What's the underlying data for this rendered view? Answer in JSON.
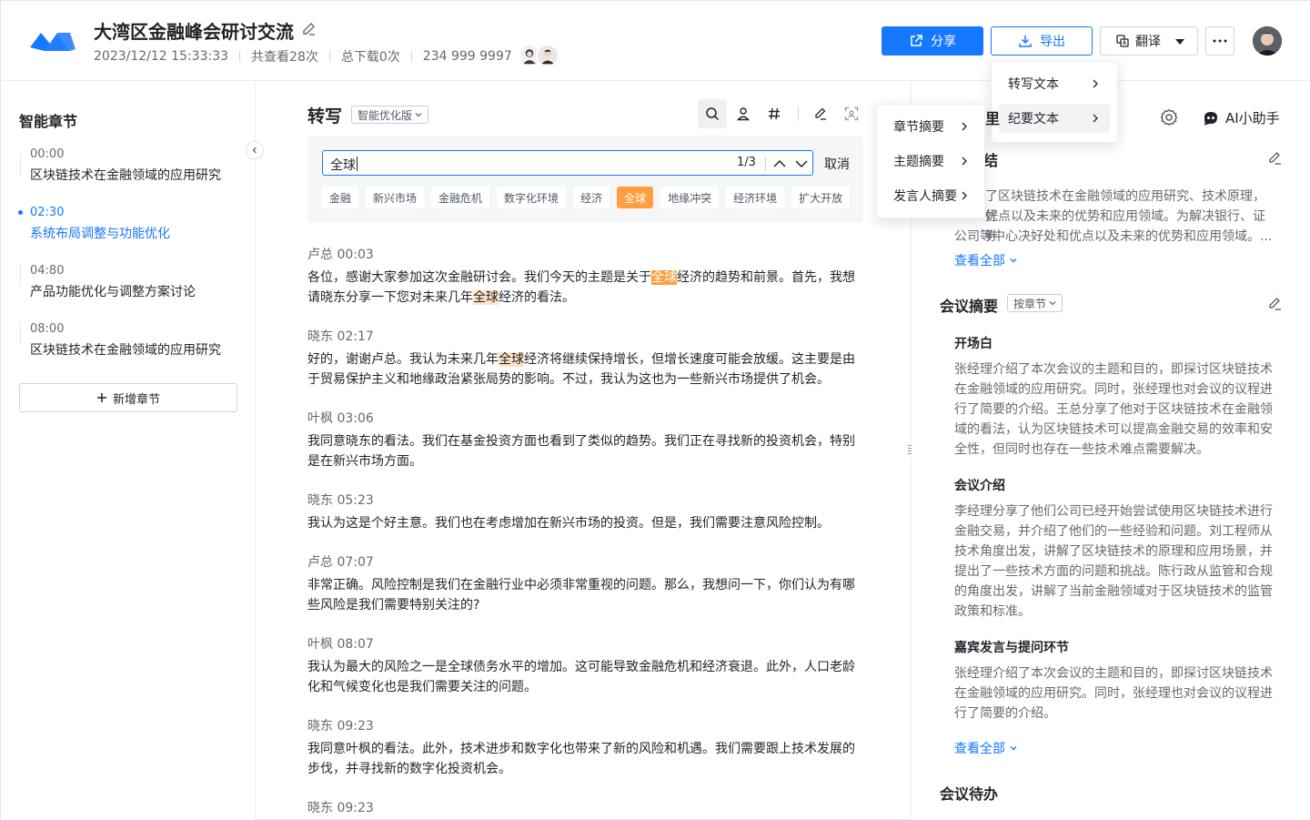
{
  "header": {
    "title": "大湾区金融峰会研讨交流",
    "datetime": "2023/12/12 15:33:33",
    "views": "共查看28次",
    "downloads": "总下载0次",
    "phone": "234 999 9997",
    "share_label": "分享",
    "export_label": "导出",
    "translate_label": "翻译"
  },
  "chapters": {
    "title": "智能章节",
    "add_label": "新增章节",
    "items": [
      {
        "time": "00:00",
        "name": "区块链技术在金融领域的应用研究"
      },
      {
        "time": "02:30",
        "name": "系统布局调整与功能优化"
      },
      {
        "time": "04:80",
        "name": "产品功能优化与调整方案讨论"
      },
      {
        "time": "08:00",
        "name": "区块链技术在金融领域的应用研究"
      }
    ]
  },
  "transcript": {
    "title": "转写",
    "version": "智能优化版",
    "search": {
      "value": "全球",
      "count": "1/3",
      "cancel": "取消",
      "tags": [
        "金融",
        "新兴市场",
        "金融危机",
        "数字化环境",
        "经济",
        "全球",
        "地缘冲突",
        "经济环境",
        "扩大开放"
      ]
    },
    "entries": [
      {
        "speaker": "卢总 00:03",
        "p1": "各位，感谢大家参加这次金融研讨会。我们今天的主题是关于",
        "h1": "全球",
        "p2": "经济的趋势和前景。首先，我想请晓东分享一下您对未来几年",
        "h2": "全球",
        "p3": "经济的看法。"
      },
      {
        "speaker": "晓东 02:17",
        "p1": "好的，谢谢卢总。我认为未来几年",
        "h1": "全球",
        "p2": "经济将继续保持增长，但增长速度可能会放缓。这主要是由于贸易保护主义和地缘政治紧张局势的影响。不过，我认为这也为一些新兴市场提供了机会。"
      },
      {
        "speaker": "叶枫 03:06",
        "text": "我同意晓东的看法。我们在基金投资方面也看到了类似的趋势。我们正在寻找新的投资机会，特别是在新兴市场方面。"
      },
      {
        "speaker": "晓东 05:23",
        "text": "我认为这是个好主意。我们也在考虑增加在新兴市场的投资。但是，我们需要注意风险控制。"
      },
      {
        "speaker": "卢总 07:07",
        "text": "非常正确。风险控制是我们在金融行业中必须非常重视的问题。那么，我想问一下，你们认为有哪些风险是我们需要特别关注的?"
      },
      {
        "speaker": "叶枫 08:07",
        "text": "我认为最大的风险之一是全球债务水平的增加。这可能导致金融危机和经济衰退。此外，人口老龄化和气候变化也是我们需要关注的问题。"
      },
      {
        "speaker": "晓东 09:23",
        "text": "我同意叶枫的看法。此外，技术进步和数字化也带来了新的风险和机遇。我们需要跟上技术发展的步伐，并寻找新的数字化投资机会。"
      },
      {
        "speaker": "晓东 09:23",
        "text": ""
      }
    ]
  },
  "right": {
    "ai_label": "AI小助手",
    "summary_title_partial": "结",
    "summary_heading_partial": "里",
    "summary_text": "了区块链技术在金融领域的应用研究、技术原理，好优点以及未来的优势和应用领域。为解决银行、证券公司等中心决好处和优点以及未来的优势和应用领域。...",
    "summary_line1": "了区块链技术在金融领域的应用研究、技术原理，好",
    "summary_line2": "优点以及未来的优势和应用领域。为解决银行、证券",
    "summary_line3": "公司等中心决好处和优点以及未来的优势和应用领域。...",
    "view_all": "查看全部",
    "minutes_title": "会议摘要",
    "minutes_mode": "按章节",
    "sections": [
      {
        "title": "开场白",
        "text": "张经理介绍了本次会议的主题和目的，即探讨区块链技术在金融领域的应用研究。同时，张经理也对会议的议程进行了简要的介绍。王总分享了他对于区块链技术在金融领域的看法，认为区块链技术可以提高金融交易的效率和安全性，但同时也存在一些技术难点需要解决。"
      },
      {
        "title": "会议介绍",
        "text": "李经理分享了他们公司已经开始尝试使用区块链技术进行金融交易，并介绍了他们的一些经验和问题。刘工程师从技术角度出发，讲解了区块链技术的原理和应用场景，并提出了一些技术方面的问题和挑战。陈行政从监管和合规的角度出发，讲解了当前金融领域对于区块链技术的监管政策和标准。"
      },
      {
        "title": "嘉宾发言与提问环节",
        "text": "张经理介绍了本次会议的主题和目的，即探讨区块链技术在金融领域的应用研究。同时，张经理也对会议的议程进行了简要的介绍。"
      }
    ],
    "todo_title": "会议待办"
  },
  "export_menu": {
    "items": [
      "转写文本",
      "纪要文本"
    ]
  },
  "sub_menu": {
    "items": [
      "章节摘要",
      "主题摘要",
      "发言人摘要"
    ]
  },
  "colors": {
    "accent": "#1677ff",
    "highlight": "#ff9f40",
    "highlight_soft": "#ffe2c4"
  }
}
